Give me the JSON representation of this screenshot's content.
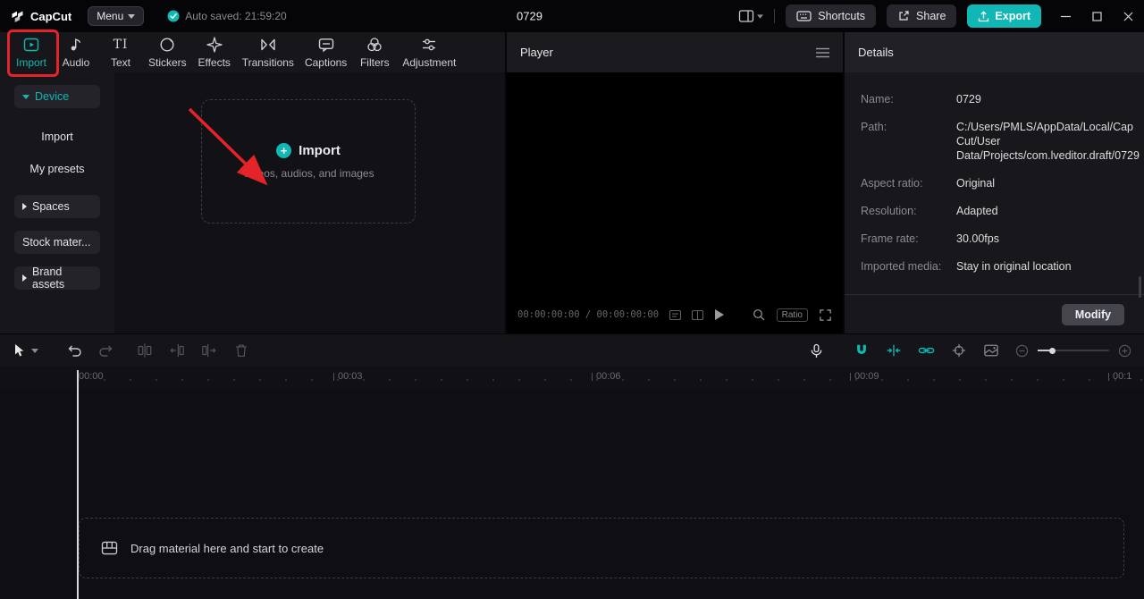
{
  "titlebar": {
    "app_name": "CapCut",
    "menu": "Menu",
    "autosave": "Auto saved: 21:59:20",
    "project_title": "0729",
    "shortcuts": "Shortcuts",
    "share": "Share",
    "export": "Export"
  },
  "tabs": [
    {
      "label": "Import"
    },
    {
      "label": "Audio"
    },
    {
      "label": "Text"
    },
    {
      "label": "Stickers"
    },
    {
      "label": "Effects"
    },
    {
      "label": "Transitions"
    },
    {
      "label": "Captions"
    },
    {
      "label": "Filters"
    },
    {
      "label": "Adjustment"
    }
  ],
  "text_tab_icon_glyph": "TI",
  "sidebar": {
    "device": "Device",
    "import": "Import",
    "my_presets": "My presets",
    "spaces": "Spaces",
    "stock_material": "Stock mater...",
    "brand_assets": "Brand assets"
  },
  "import_zone": {
    "title": "Import",
    "subtitle": "Videos, audios, and images",
    "plus_glyph": "+"
  },
  "player": {
    "title": "Player",
    "timecode": "00:00:00:00 / 00:00:00:00",
    "ratio": "Ratio"
  },
  "details": {
    "title": "Details",
    "rows": [
      {
        "label": "Name:",
        "value": "0729"
      },
      {
        "label": "Path:",
        "value": "C:/Users/PMLS/AppData/Local/CapCut/User Data/Projects/com.lveditor.draft/0729"
      },
      {
        "label": "Aspect ratio:",
        "value": "Original"
      },
      {
        "label": "Resolution:",
        "value": "Adapted"
      },
      {
        "label": "Frame rate:",
        "value": "30.00fps"
      },
      {
        "label": "Imported media:",
        "value": "Stay in original location"
      }
    ],
    "modify": "Modify"
  },
  "timeline": {
    "ruler": [
      "00:00",
      "00:03",
      "00:06",
      "00:09",
      "00:1"
    ],
    "drop_hint": "Drag material here and start to create"
  },
  "colors": {
    "accent": "#11b7b4",
    "annotation_red": "#e5232b"
  }
}
